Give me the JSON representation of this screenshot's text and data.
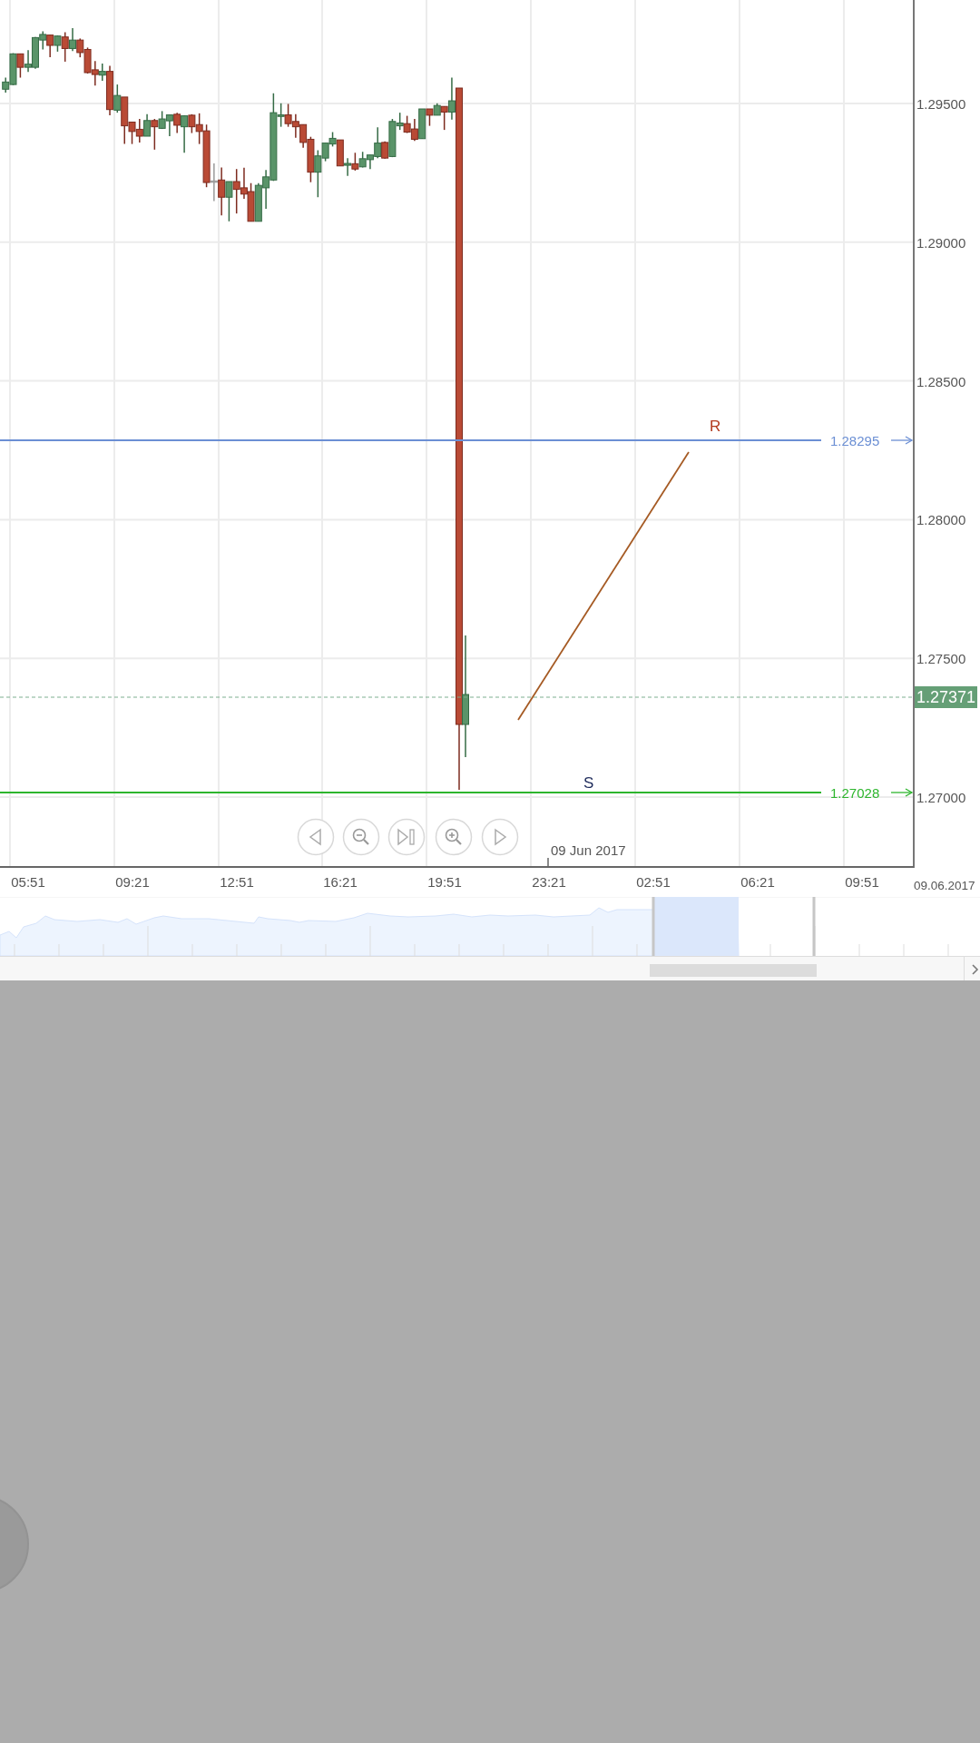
{
  "y_axis": {
    "ticks": [
      "1.29500",
      "1.29000",
      "1.28500",
      "1.28000",
      "1.27500",
      "1.27000"
    ]
  },
  "x_axis": {
    "ticks": [
      "05:51",
      "09:21",
      "12:51",
      "16:21",
      "19:51",
      "23:21",
      "02:51",
      "06:21",
      "09:51"
    ],
    "date_marker": "09 Jun 2017",
    "end_date": "09.06.2017"
  },
  "price_lines": [
    {
      "label": "1.28295",
      "color": "#6b8fd4"
    },
    {
      "label": "1.27028",
      "color": "#2db52d"
    }
  ],
  "current_price": {
    "label": "1.27371"
  },
  "annotations": [
    {
      "kind": "resistance",
      "label": "R"
    },
    {
      "kind": "support",
      "label": "S"
    }
  ],
  "nav_buttons": [
    {
      "kind": "prev"
    },
    {
      "kind": "zoom_out"
    },
    {
      "kind": "end"
    },
    {
      "kind": "zoom_in"
    },
    {
      "kind": "next"
    }
  ]
}
